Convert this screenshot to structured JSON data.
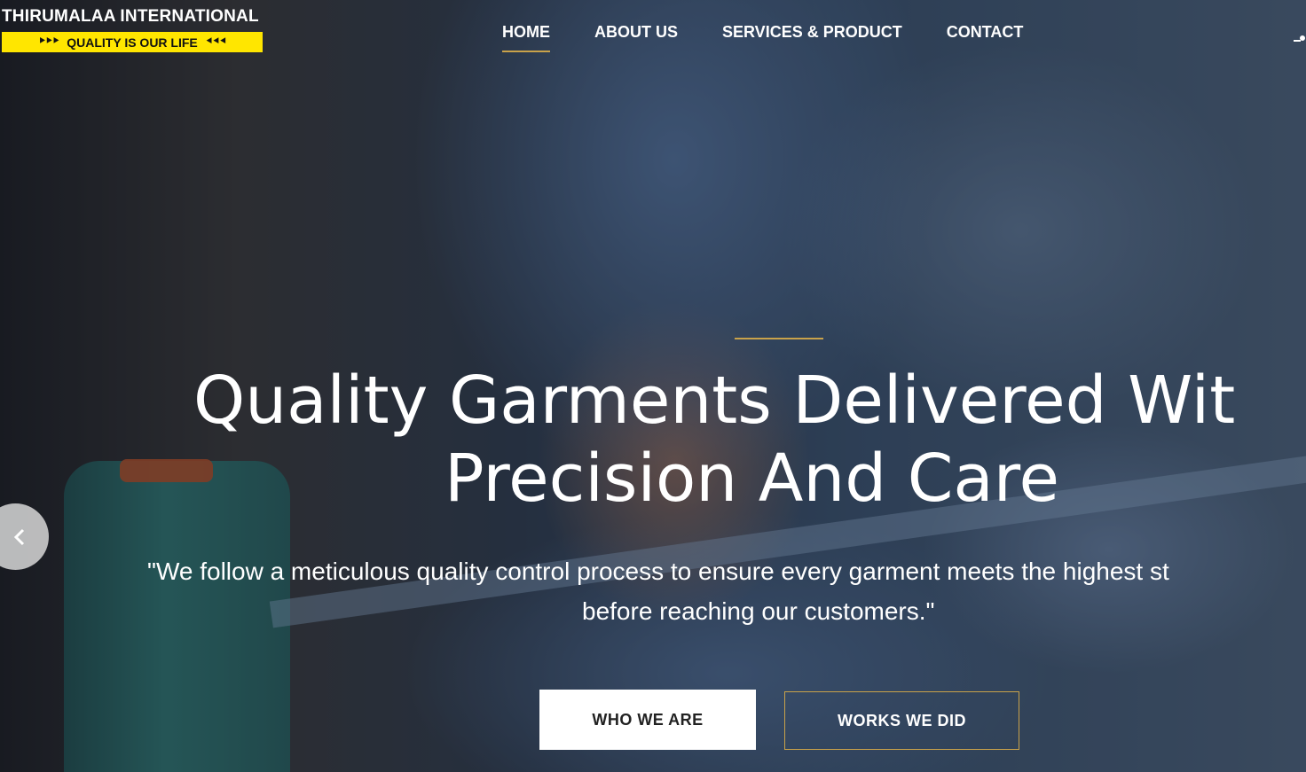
{
  "brand": {
    "name": "THIRUMALAA INTERNATIONAL",
    "tagline": "QUALITY IS OUR LIFE",
    "tag_left": "⯈⯈⯈",
    "tag_right": "⯇⯇⯇",
    "tag_color": "#ffe600"
  },
  "nav": {
    "items": [
      {
        "label": "HOME",
        "active": true
      },
      {
        "label": "ABOUT US",
        "active": false
      },
      {
        "label": "SERVICES & PRODUCT",
        "active": false
      },
      {
        "label": "CONTACT",
        "active": false
      }
    ],
    "accent": "#c9a24a"
  },
  "hero": {
    "headline_line1": "Quality Garments Delivered Wit",
    "headline_line2": "Precision And Care",
    "quote_line1": "\"We follow a meticulous quality control process to ensure every garment meets the highest st",
    "quote_line2": "before reaching our customers.\"",
    "primary_button": "WHO WE ARE",
    "secondary_button": "WORKS WE DID",
    "prev_icon": "chevron-left-icon"
  }
}
